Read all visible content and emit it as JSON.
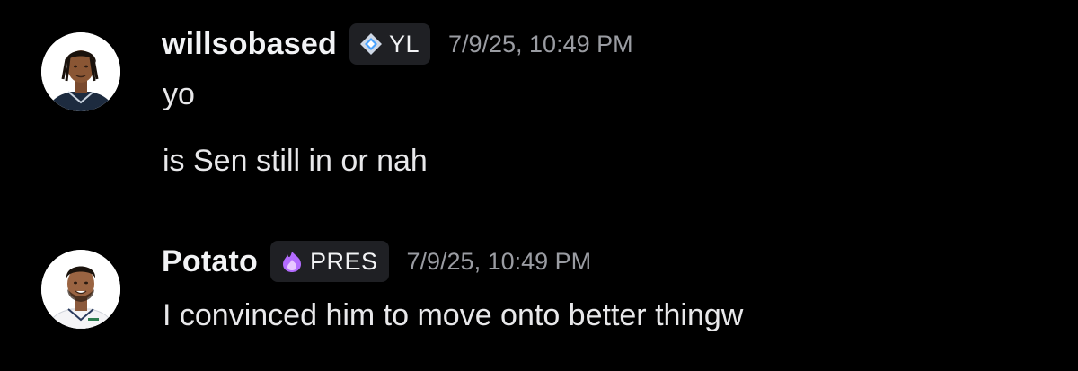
{
  "messages": [
    {
      "username": "willsobased",
      "tag": {
        "icon": "diamond-sparkle-icon",
        "text": "YL"
      },
      "timestamp": "7/9/25, 10:49 PM",
      "lines": [
        "yo",
        "is Sen still in or nah"
      ]
    },
    {
      "username": "Potato",
      "tag": {
        "icon": "purple-flame-icon",
        "text": "PRES"
      },
      "timestamp": "7/9/25, 10:49 PM",
      "lines": [
        "I convinced him to move onto better thingw"
      ]
    }
  ],
  "colors": {
    "background": "#000000",
    "username": "#f2f3f5",
    "message_text": "#e8e8ea",
    "timestamp": "#9a9ca2",
    "tag_background": "#1f2024",
    "tag_icon_blue": "#4aa3ff",
    "tag_icon_purple": "#b36bff"
  }
}
